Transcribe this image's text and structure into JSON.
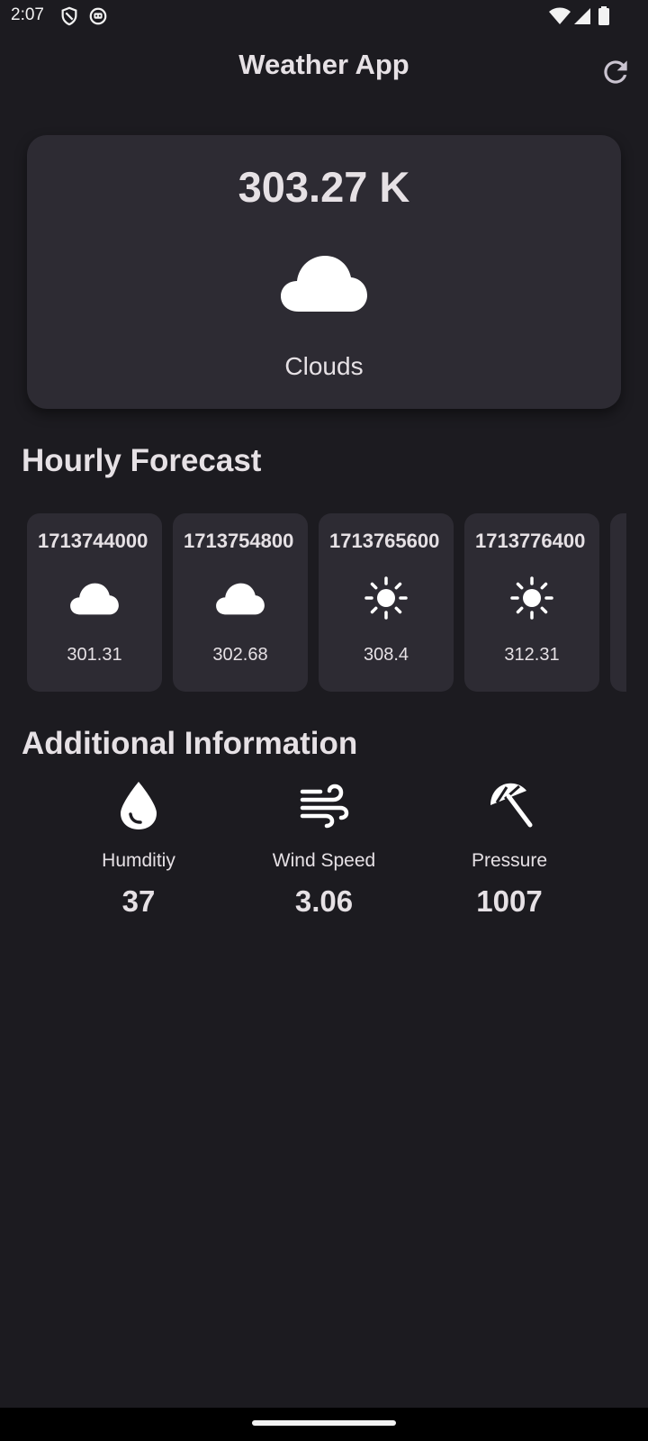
{
  "status_bar": {
    "time": "2:07"
  },
  "app_bar": {
    "title": "Weather App",
    "refresh_icon": "refresh-icon"
  },
  "current": {
    "temperature": "303.27 K",
    "icon": "cloud-icon",
    "condition": "Clouds"
  },
  "hourly": {
    "title": "Hourly Forecast",
    "items": [
      {
        "time": "1713744000",
        "icon": "cloud-icon",
        "temp": "301.31"
      },
      {
        "time": "1713754800",
        "icon": "cloud-icon",
        "temp": "302.68"
      },
      {
        "time": "1713765600",
        "icon": "sun-icon",
        "temp": "308.4"
      },
      {
        "time": "1713776400",
        "icon": "sun-icon",
        "temp": "312.31"
      }
    ]
  },
  "additional": {
    "title": "Additional Information",
    "items": [
      {
        "icon": "water-drop-icon",
        "label": "Humditiy",
        "value": "37"
      },
      {
        "icon": "wind-icon",
        "label": "Wind Speed",
        "value": "3.06"
      },
      {
        "icon": "beach-umbrella-icon",
        "label": "Pressure",
        "value": "1007"
      }
    ]
  },
  "colors": {
    "background": "#1c1b20",
    "card": "#2d2b33",
    "text": "#e6e1e5"
  }
}
